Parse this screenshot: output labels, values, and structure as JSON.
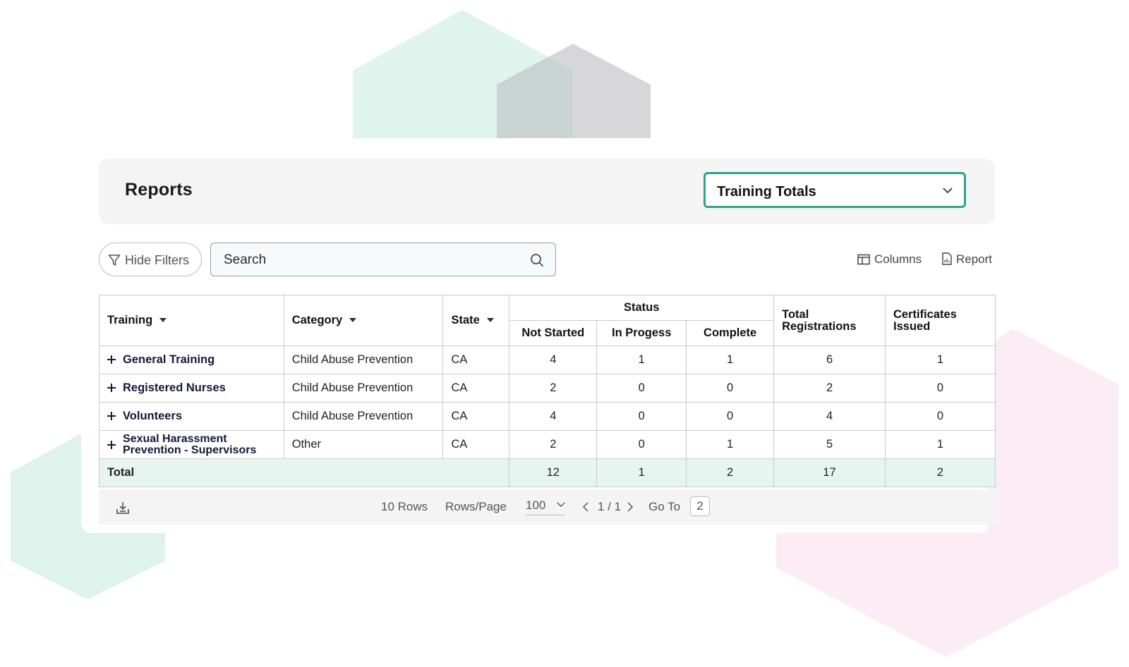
{
  "header": {
    "title": "Reports",
    "report_select": {
      "value": "Training Totals"
    }
  },
  "toolbar": {
    "hide_filters_label": "Hide Filters",
    "search_placeholder": "Search",
    "columns_label": "Columns",
    "report_label": "Report"
  },
  "table": {
    "headers": {
      "training": "Training",
      "category": "Category",
      "state": "State",
      "status": "Status",
      "not_started": "Not Started",
      "in_progress": "In Progess",
      "complete": "Complete",
      "total_registrations_1": "Total",
      "total_registrations_2": "Registrations",
      "certificates_issued_1": "Certificates",
      "certificates_issued_2": "Issued"
    },
    "rows": [
      {
        "training": "General Training",
        "category": "Child Abuse Prevention",
        "state": "CA",
        "not_started": "4",
        "in_progress": "1",
        "complete": "1",
        "total_registrations": "6",
        "certificates_issued": "1"
      },
      {
        "training": "Registered Nurses",
        "category": "Child Abuse Prevention",
        "state": "CA",
        "not_started": "2",
        "in_progress": "0",
        "complete": "0",
        "total_registrations": "2",
        "certificates_issued": "0"
      },
      {
        "training": "Volunteers",
        "category": "Child Abuse Prevention",
        "state": "CA",
        "not_started": "4",
        "in_progress": "0",
        "complete": "0",
        "total_registrations": "4",
        "certificates_issued": "0"
      },
      {
        "training_line1": "Sexual Harassment",
        "training_line2": "Prevention - Supervisors",
        "category": "Other",
        "state": "CA",
        "not_started": "2",
        "in_progress": "0",
        "complete": "1",
        "total_registrations": "5",
        "certificates_issued": "1"
      }
    ],
    "total": {
      "label": "Total",
      "not_started": "12",
      "in_progress": "1",
      "complete": "2",
      "total_registrations": "17",
      "certificates_issued": "2"
    }
  },
  "footer": {
    "rows_count": "10 Rows",
    "rows_per_page_label": "Rows/Page",
    "rows_per_page_value": "100",
    "page_indicator": "1 / 1",
    "goto_label": "Go To",
    "goto_value": "2"
  },
  "colors": {
    "accent": "#2ba58f",
    "total_row_bg": "#e7f5f1",
    "header_bg": "#f4f4f4",
    "deco_teal": "#d9f2ea",
    "deco_gray": "#c8c8cc",
    "deco_pink": "#fcebf4"
  },
  "icons": {
    "filter": "funnel-icon",
    "search": "magnifier-icon",
    "columns": "columns-icon",
    "report": "report-file-icon",
    "download": "download-icon",
    "dropdown": "chevron-down-icon"
  }
}
